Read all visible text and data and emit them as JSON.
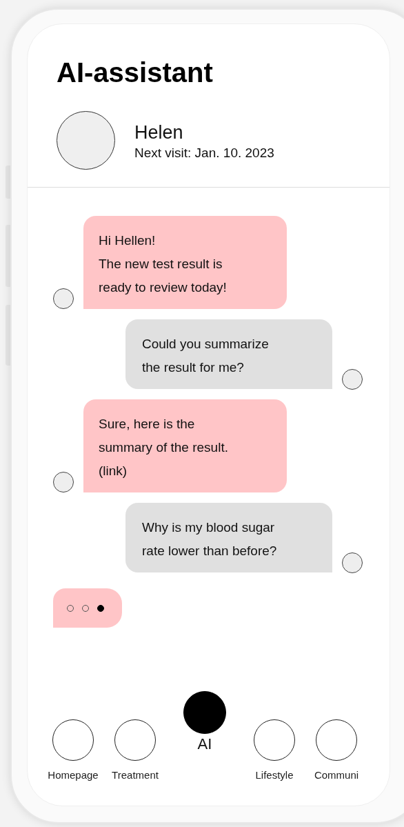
{
  "title": "AI-assistant",
  "profile": {
    "name": "Helen",
    "next_visit": "Next visit: Jan. 10. 2023"
  },
  "messages": [
    {
      "kind": "bot",
      "lines": [
        "Hi Hellen!",
        "The new test result is",
        "ready to review today!"
      ]
    },
    {
      "kind": "user",
      "lines": [
        "Could you summarize",
        "the result for me?"
      ]
    },
    {
      "kind": "bot",
      "lines": [
        "Sure, here is the",
        "summary of the result.",
        "(link)"
      ]
    },
    {
      "kind": "user",
      "lines": [
        "Why is my blood sugar",
        "rate lower than before?"
      ]
    }
  ],
  "typing": [
    {
      "filled": false
    },
    {
      "filled": false
    },
    {
      "filled": true
    }
  ],
  "nav": [
    {
      "label": "Homepage",
      "selected": false
    },
    {
      "label": "Treatment",
      "selected": false
    },
    {
      "label": "AI",
      "selected": true
    },
    {
      "label": "Lifestyle",
      "selected": false
    },
    {
      "label": "Communi",
      "selected": false
    }
  ]
}
